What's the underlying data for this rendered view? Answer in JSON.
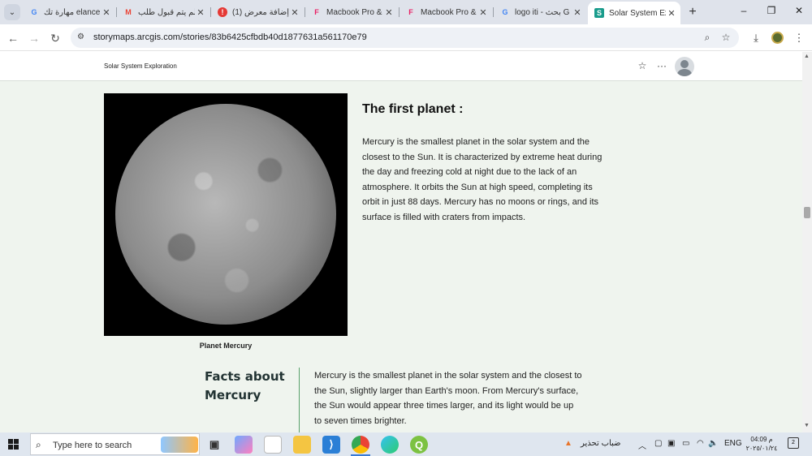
{
  "browser": {
    "tabs": [
      {
        "title": "مهارة تك elancer",
        "favicon": "G",
        "favicon_color": "#4285f4",
        "active": false
      },
      {
        "title": "لم يتم قبول طلب",
        "favicon": "M",
        "favicon_color": "#ea4335",
        "active": false
      },
      {
        "title": "(1) إضافة معرض",
        "favicon": "!",
        "favicon_color": "#e53935",
        "active": false
      },
      {
        "title": "Macbook Pro &",
        "favicon": "F",
        "favicon_color": "#e91e63",
        "active": false
      },
      {
        "title": "Macbook Pro &",
        "favicon": "F",
        "favicon_color": "#e91e63",
        "active": false
      },
      {
        "title": "logo iti - بحث G",
        "favicon": "G",
        "favicon_color": "#4285f4",
        "active": false
      },
      {
        "title": "Solar System Ex",
        "favicon": "S",
        "favicon_color": "#1a9c8c",
        "active": true
      }
    ],
    "new_tab": "+",
    "window_controls": {
      "minimize": "–",
      "restore": "❐",
      "close": "✕"
    },
    "url": "storymaps.arcgis.com/stories/83b6425cfbdb40d1877631a561170e79",
    "nav": {
      "back": "←",
      "forward": "→",
      "reload": "↻"
    },
    "toolbar_icons": {
      "zoom": "⌕",
      "bookmark": "☆",
      "download": "⤓",
      "menu": "⋮"
    }
  },
  "story": {
    "header_title": "Solar System Exploration",
    "header_icons": {
      "favorite": "☆",
      "more": "···"
    },
    "image_caption": "Planet Mercury",
    "section_heading": "The first planet :",
    "section_text": "Mercury is the smallest planet in the solar system and the closest to the Sun. It is characterized by extreme heat during the day and freezing cold at night due to the lack of an atmosphere. It orbits the Sun at high speed, completing its orbit in just 88 days. Mercury has no moons or rings, and its surface is filled with craters from impacts.",
    "facts_title": "Facts about Mercury",
    "facts_text": "Mercury is the smallest planet in the solar system and the closest to the Sun, slightly larger than Earth's moon. From Mercury's surface, the Sun would appear three times larger, and its light would be up to seven times brighter."
  },
  "scrollbar": {
    "up": "▲",
    "down": "▼"
  },
  "taskbar": {
    "search_placeholder": "Type here to search",
    "weather_text": "ضباب تحذير",
    "language": "ENG",
    "time": "04:09 م",
    "date": "٢٠٢٥/٠١/٢٤",
    "tray_icons": {
      "chevron": "︿",
      "wifi": "◠",
      "volume": "🔈",
      "battery": "▭"
    }
  }
}
